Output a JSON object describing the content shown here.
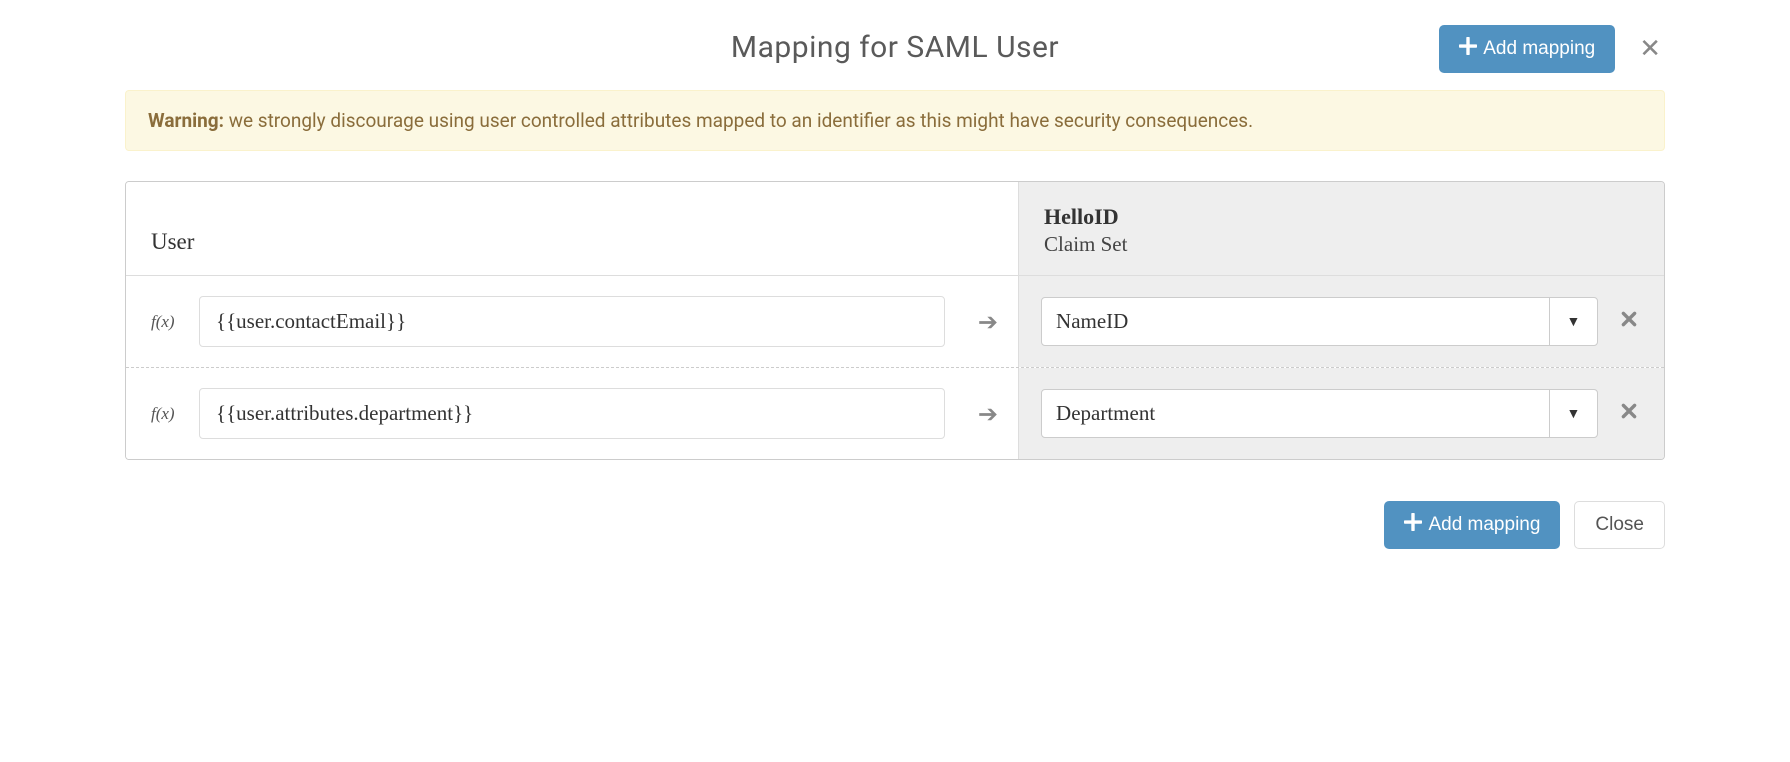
{
  "header": {
    "title": "Mapping for SAML User",
    "add_mapping_label": "Add mapping"
  },
  "alert": {
    "prefix": "Warning:",
    "text": " we strongly discourage using user controlled attributes mapped to an identifier as this might have security consequences."
  },
  "table": {
    "left_header": "User",
    "right_header_title": "HelloID",
    "right_header_subtitle": "Claim Set",
    "fx_label": "f(x)",
    "rows": [
      {
        "source": "{{user.contactEmail}}",
        "target": "NameID"
      },
      {
        "source": "{{user.attributes.department}}",
        "target": "Department"
      }
    ]
  },
  "footer": {
    "add_mapping_label": "Add mapping",
    "close_label": "Close"
  }
}
